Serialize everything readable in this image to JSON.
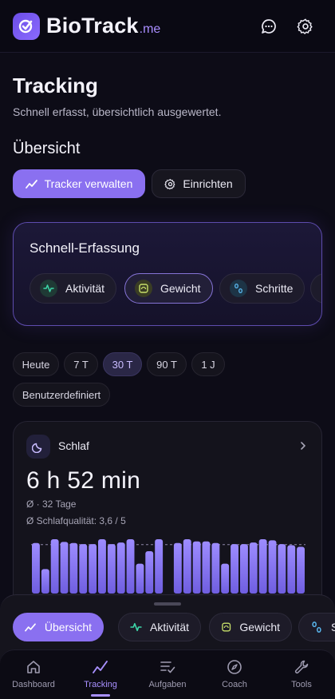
{
  "header": {
    "brand": "BioTrack",
    "brand_suffix": ".me",
    "icons": [
      "logo-icon",
      "chat-icon",
      "settings-icon"
    ]
  },
  "page": {
    "title": "Tracking",
    "subtitle": "Schnell erfasst, übersichtlich ausgewertet.",
    "section_title": "Übersicht",
    "actions": {
      "manage_trackers": "Tracker verwalten",
      "setup": "Einrichten"
    }
  },
  "quick_capture": {
    "title": "Schnell-Erfassung",
    "items": [
      {
        "label": "Aktivität",
        "icon": "activity-icon",
        "color": "#3dd6a8"
      },
      {
        "label": "Gewicht",
        "icon": "weight-icon",
        "color": "#c8e06a",
        "selected": true
      },
      {
        "label": "Schritte",
        "icon": "steps-icon",
        "color": "#5ab8f0"
      }
    ]
  },
  "ranges": {
    "options": [
      "Heute",
      "7 T",
      "30 T",
      "90 T",
      "1 J",
      "Benutzerdefiniert"
    ],
    "selected": "30 T"
  },
  "sleep_card": {
    "label": "Schlaf",
    "value": "6 h 52 min",
    "avg_note": "Ø · 32 Tage",
    "quality": "Ø Schlafqualität: 3,6 / 5"
  },
  "chart_data": {
    "type": "bar",
    "series": [
      {
        "values": [
          0.93,
          0.45,
          1.0,
          0.95,
          0.93,
          0.91,
          0.91,
          1.0,
          0.91,
          0.94,
          1.0,
          0.55,
          0.78,
          1.0,
          0.0,
          0.93,
          1.0,
          0.96,
          0.96,
          0.93,
          0.55,
          0.91,
          0.91,
          0.94,
          1.0,
          0.98,
          0.91,
          0.89,
          0.86
        ]
      }
    ],
    "reference_line": 0.9,
    "note": "bar heights as fraction of max; vertical axis unlabeled"
  },
  "bottom_sheet": {
    "chips": [
      {
        "label": "Übersicht",
        "icon": "chart-icon",
        "active": true
      },
      {
        "label": "Aktivität",
        "icon": "activity-icon",
        "active": false
      },
      {
        "label": "Gewicht",
        "icon": "weight-icon",
        "active": false
      },
      {
        "label": "S",
        "icon": "steps-icon",
        "active": false
      }
    ]
  },
  "nav": {
    "items": [
      {
        "label": "Dashboard",
        "icon": "home-icon"
      },
      {
        "label": "Tracking",
        "icon": "tracking-icon",
        "active": true
      },
      {
        "label": "Aufgaben",
        "icon": "tasks-icon"
      },
      {
        "label": "Coach",
        "icon": "compass-icon"
      },
      {
        "label": "Tools",
        "icon": "wrench-icon"
      }
    ]
  },
  "colors": {
    "accent": "#8a70f0",
    "background": "#0d0c17",
    "nav_active": "#a890ff"
  }
}
